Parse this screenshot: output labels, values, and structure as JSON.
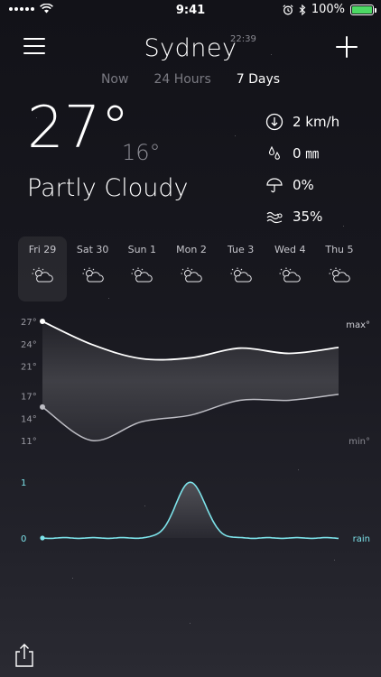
{
  "status_bar": {
    "time": "9:41",
    "battery": "100%",
    "battery_level": 1.0
  },
  "header": {
    "city": "Sydney",
    "local_time": "22:39",
    "tabs": [
      {
        "label": "Now",
        "active": false
      },
      {
        "label": "24 Hours",
        "active": false
      },
      {
        "label": "7 Days",
        "active": true
      }
    ]
  },
  "current": {
    "temp": "27°",
    "low": "16°",
    "condition": "Partly Cloudy",
    "details": [
      {
        "icon": "wind-direction-icon",
        "value": "2 km/h"
      },
      {
        "icon": "raindrops-icon",
        "value": "0 ㎜"
      },
      {
        "icon": "umbrella-icon",
        "value": "0%"
      },
      {
        "icon": "humidity-icon",
        "value": "35%"
      }
    ]
  },
  "days": [
    {
      "label": "Fri 29",
      "icon": "partly-cloudy-icon",
      "selected": true
    },
    {
      "label": "Sat 30",
      "icon": "partly-cloudy-icon",
      "selected": false
    },
    {
      "label": "Sun 1",
      "icon": "partly-cloudy-icon",
      "selected": false
    },
    {
      "label": "Mon 2",
      "icon": "partly-cloudy-icon",
      "selected": false
    },
    {
      "label": "Tue 3",
      "icon": "partly-cloudy-icon",
      "selected": false
    },
    {
      "label": "Wed 4",
      "icon": "partly-cloudy-icon",
      "selected": false
    },
    {
      "label": "Thu 5",
      "icon": "partly-cloudy-icon",
      "selected": false
    }
  ],
  "chart_data": {
    "type": "line",
    "temp_axis": {
      "ticks": [
        "27°",
        "24°",
        "21°",
        "17°",
        "14°",
        "11°"
      ],
      "tick_values": [
        27,
        24,
        21,
        17,
        14,
        11
      ],
      "range": [
        11,
        27
      ]
    },
    "max_label": "max°",
    "min_label": "min°",
    "x": [
      "Fri 29",
      "Sat 30",
      "Sun 1",
      "Mon 2",
      "Tue 3",
      "Wed 4",
      "Thu 5"
    ],
    "series": [
      {
        "name": "max°",
        "values": [
          27,
          23.9,
          22,
          22.1,
          23.4,
          22.7,
          23.5
        ]
      },
      {
        "name": "min°",
        "values": [
          15.5,
          11,
          13.5,
          14.4,
          16.4,
          16.4,
          17.2
        ]
      }
    ],
    "rain": {
      "label": "rain",
      "ticks": [
        "1",
        "0"
      ],
      "range": [
        0,
        1
      ],
      "values": [
        0,
        0,
        0,
        1,
        0,
        0,
        0
      ]
    },
    "colors": {
      "max": "#ffffff",
      "min": "#bdbdc4",
      "rain": "#7de3ea"
    }
  }
}
